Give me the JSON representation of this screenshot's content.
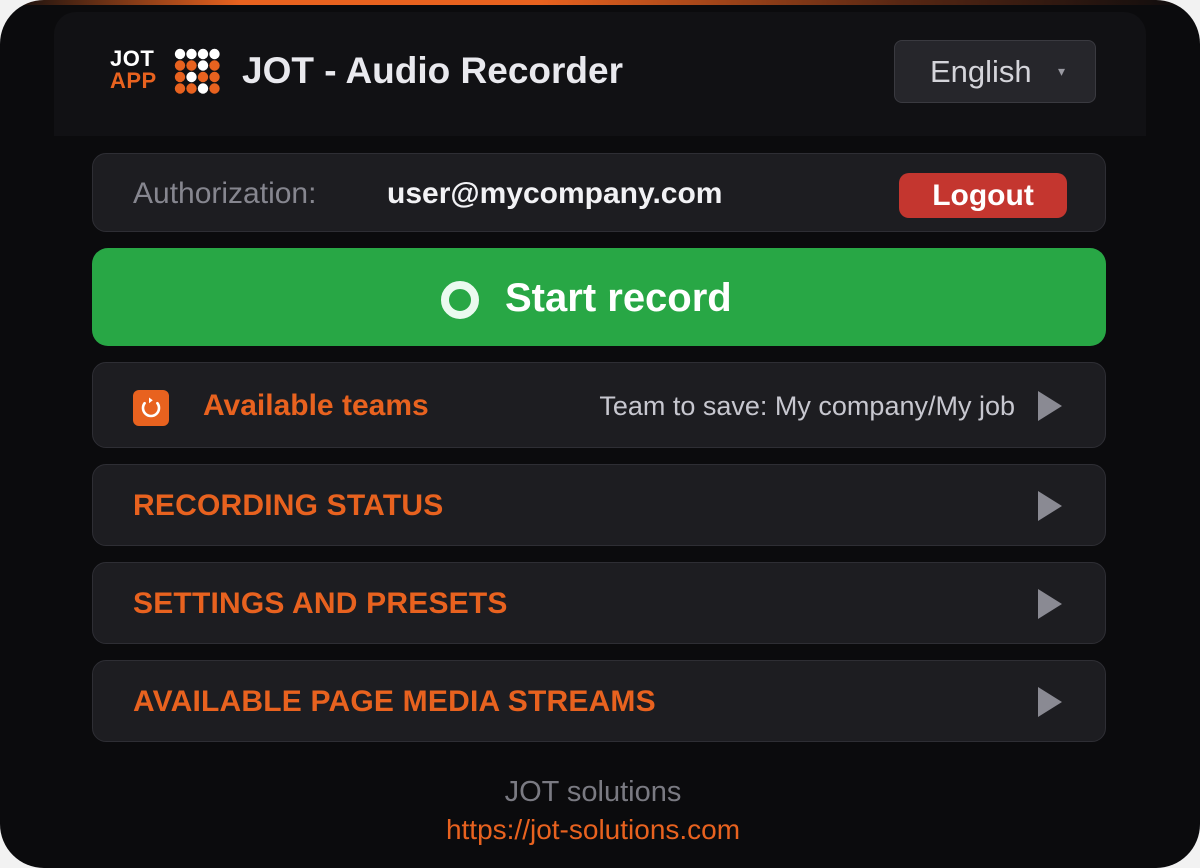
{
  "header": {
    "logo_line1": "JOT",
    "logo_line2": "APP",
    "title": "JOT - Audio Recorder",
    "language": {
      "selected": "English",
      "caret": "▾"
    }
  },
  "auth": {
    "label": "Authorization:",
    "email": "user@mycompany.com",
    "logout_label": "Logout"
  },
  "record": {
    "label": "Start record"
  },
  "teams": {
    "title": "Available teams",
    "team_to_save": "Team to save: My company/My job"
  },
  "sections": {
    "recording_status": "RECORDING STATUS",
    "settings_presets": "SETTINGS AND PRESETS",
    "media_streams": "AVAILABLE PAGE MEDIA STREAMS"
  },
  "footer": {
    "name": "JOT solutions",
    "link": "https://jot-solutions.com"
  },
  "colors": {
    "accent": "#e8621f",
    "record_green": "#28a745",
    "logout_red": "#c4362f",
    "background": "#0b0b0d",
    "panel": "#1d1d21"
  },
  "icons": {
    "logo": "jot-app-logo-icon",
    "language_caret": "chevron-down-icon",
    "record": "record-circle-icon",
    "refresh": "refresh-icon",
    "expand": "play-arrow-icon"
  }
}
